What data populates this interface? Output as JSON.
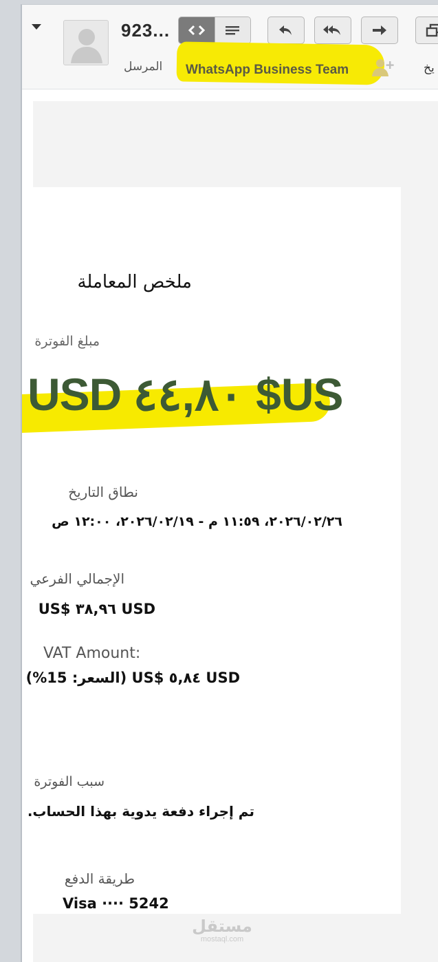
{
  "header": {
    "sender_number": "923...",
    "sender_label": "المرسل",
    "team_name": "WhatsApp Business Team",
    "truncated_label": "يخ"
  },
  "icons": {
    "code_view": "code-icon",
    "text_view": "lines-icon",
    "reply": "reply-icon",
    "reply_all": "reply-all-icon",
    "forward": "forward-icon",
    "window": "window-icon",
    "add_contact": "add-contact-icon",
    "collapse": "chevron-down-icon"
  },
  "colors": {
    "highlight": "#f7ea00",
    "amount_blue": "#3a65a8",
    "amount_on_highlight": "#3d5a35"
  },
  "email": {
    "summary_title": "ملخص المعاملة",
    "invoice_amount_label": "مبلغ الفوترة",
    "invoice_amount": "USD ٤٤,٨٠ $US",
    "date_range_label": "نطاق التاريخ",
    "date_range_value": "٢٠٢٦/٠٢/٢٦، ١١:٥٩ م - ٢٠٢٦/٠٢/١٩، ١٢:٠٠ ص",
    "subtotal_label": "الإجمالي الفرعي",
    "subtotal_value": "USD ٣٨,٩٦ $US",
    "vat_label": "VAT Amount:",
    "vat_value": "USD ٥,٨٤ $US (السعر: 15%)",
    "reason_label": "سبب الفوترة",
    "reason_value": "تم إجراء دفعة يدوية بهذا الحساب.",
    "payment_method_label": "طريقة الدفع",
    "payment_method_value": "Visa ···· 5242"
  },
  "watermark": {
    "arabic": "مستقل",
    "latin": "mostaql.com"
  }
}
